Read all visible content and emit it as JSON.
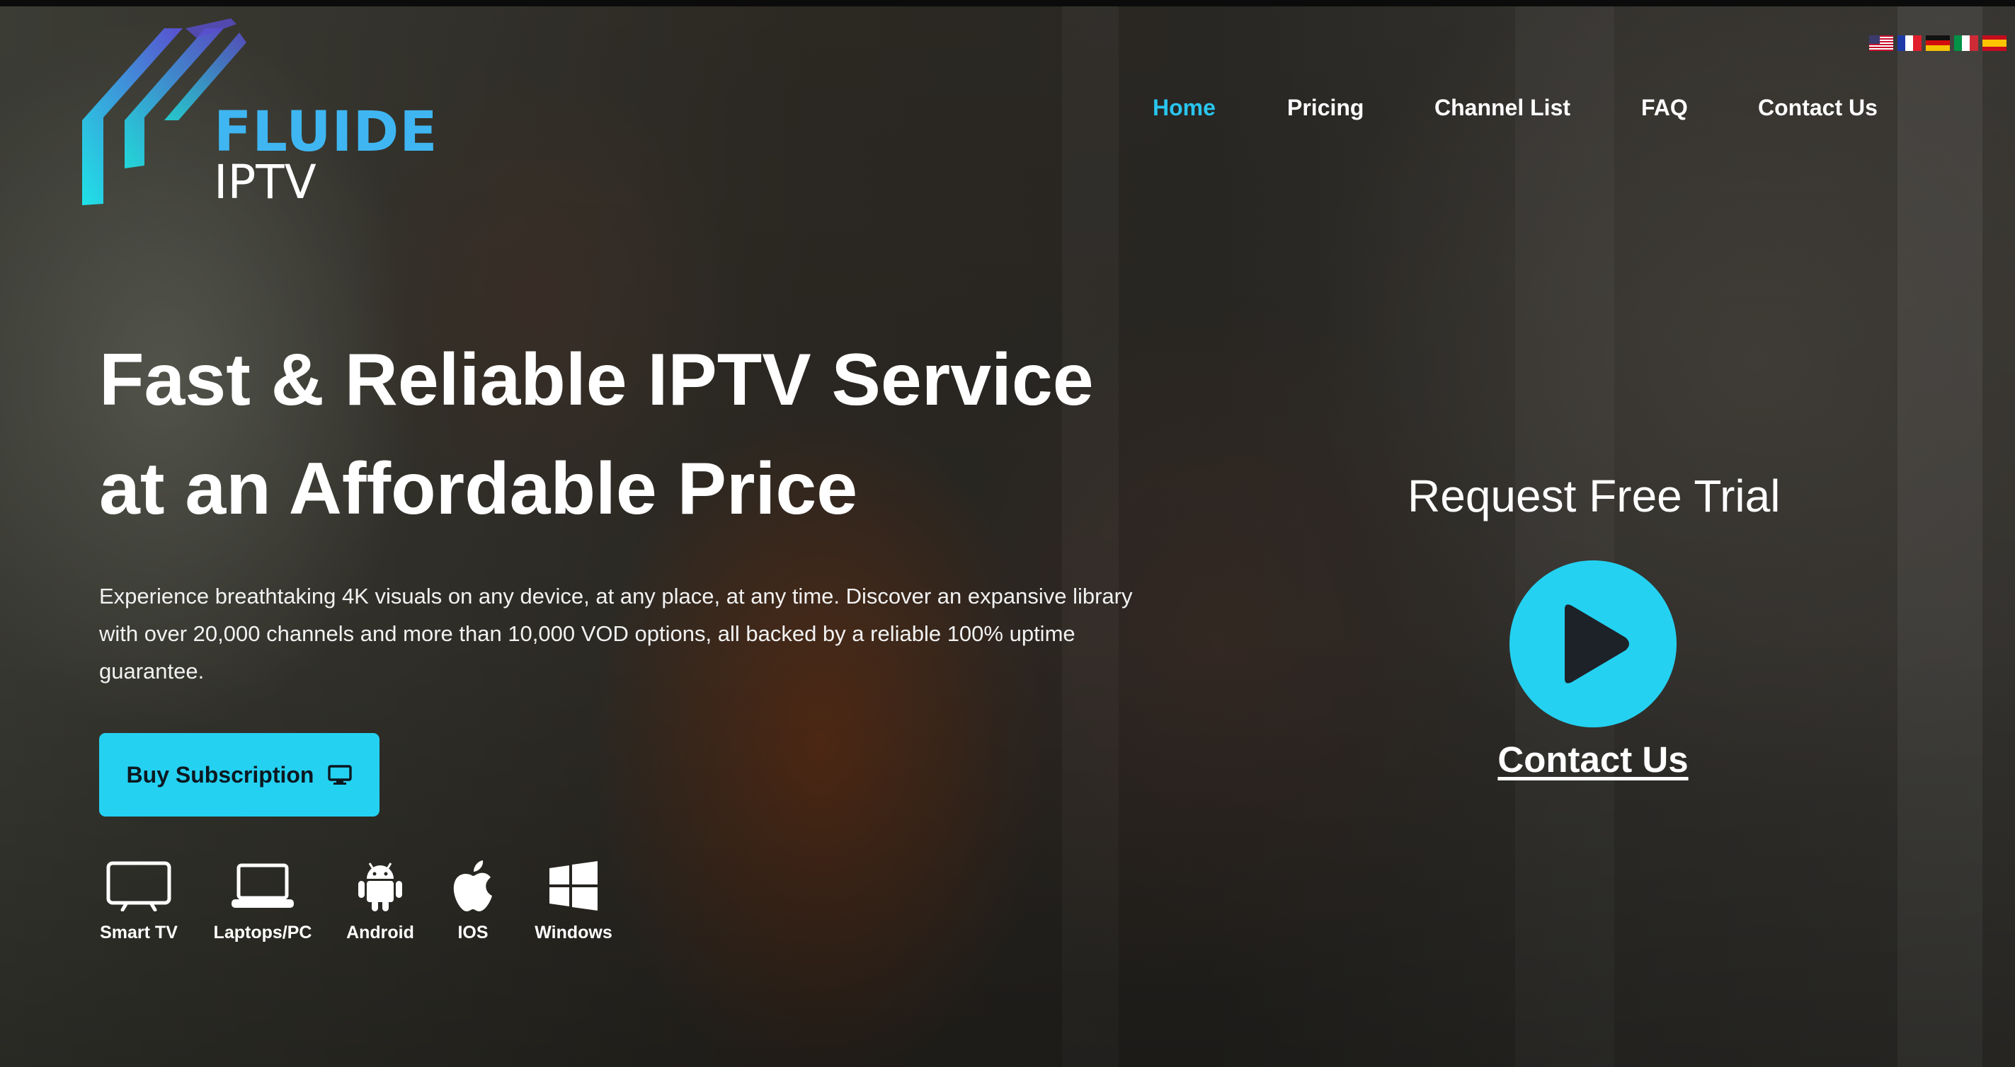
{
  "brand": {
    "name": "FLUIDE",
    "sub": "IPTV",
    "colors": {
      "accent": "#25d1f1",
      "nav_active": "#29c5ee",
      "logo_word": "#3fb6f2"
    }
  },
  "flags": [
    {
      "icon": "us-flag-icon"
    },
    {
      "icon": "fr-flag-icon"
    },
    {
      "icon": "de-flag-icon"
    },
    {
      "icon": "it-flag-icon"
    },
    {
      "icon": "es-flag-icon"
    }
  ],
  "nav": {
    "items": [
      {
        "label": "Home",
        "active": true
      },
      {
        "label": "Pricing",
        "active": false
      },
      {
        "label": "Channel List",
        "active": false
      },
      {
        "label": "FAQ",
        "active": false
      },
      {
        "label": "Contact Us",
        "active": false
      }
    ]
  },
  "hero": {
    "headline_line1": "Fast & Reliable IPTV Service",
    "headline_line2": "at an Affordable Price",
    "description": "Experience breathtaking 4K visuals on any device, at any place, at any time. Discover an expansive library with over 20,000 channels and more than 10,000 VOD options, all backed by a reliable 100% uptime guarantee.",
    "cta_label": "Buy Subscription",
    "cta_icon": "monitor-icon"
  },
  "devices": [
    {
      "label": "Smart TV",
      "icon": "smart-tv-icon"
    },
    {
      "label": "Laptops/PC",
      "icon": "laptop-icon"
    },
    {
      "label": "Android",
      "icon": "android-icon"
    },
    {
      "label": "IOS",
      "icon": "apple-icon"
    },
    {
      "label": "Windows",
      "icon": "windows-icon"
    }
  ],
  "trial": {
    "title": "Request Free Trial",
    "play_icon": "play-icon",
    "contact_label": "Contact Us"
  }
}
